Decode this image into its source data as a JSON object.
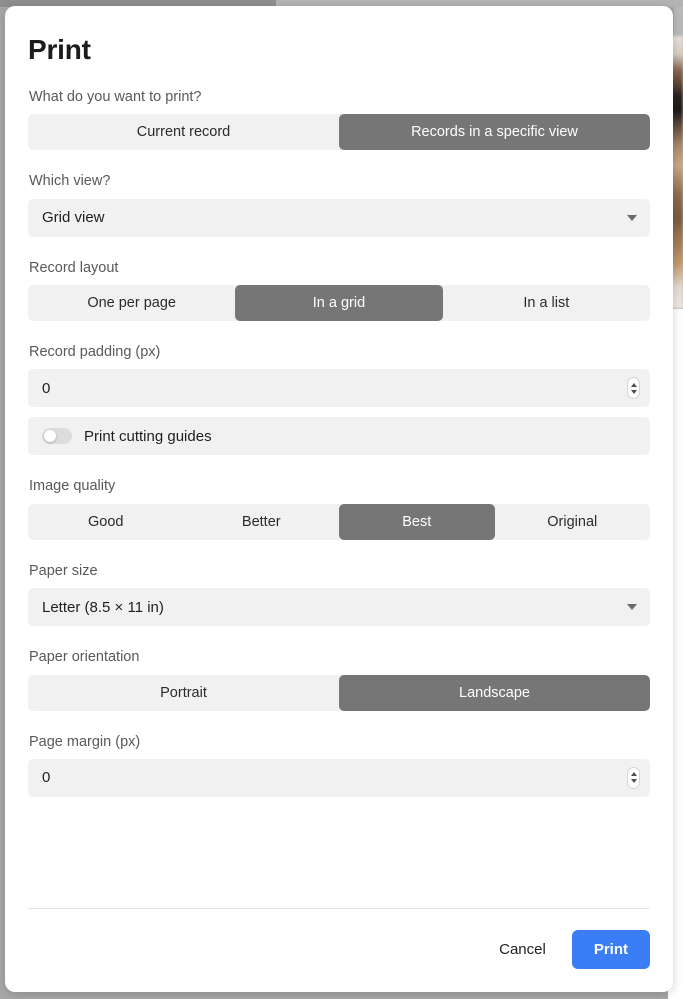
{
  "dialog": {
    "title": "Print",
    "fields": {
      "print_target": {
        "label": "What do you want to print?",
        "options": [
          "Current record",
          "Records in a specific view"
        ],
        "selected_index": 1
      },
      "which_view": {
        "label": "Which view?",
        "value": "Grid view",
        "caret_icon": "chevron-down-icon"
      },
      "record_layout": {
        "label": "Record layout",
        "options": [
          "One per page",
          "In a grid",
          "In a list"
        ],
        "selected_index": 1
      },
      "record_padding": {
        "label": "Record padding (px)",
        "value": "0",
        "stepper_up_icon": "chevron-up-icon",
        "stepper_down_icon": "chevron-down-icon"
      },
      "cutting_guides": {
        "label": "Print cutting guides",
        "enabled": false
      },
      "image_quality": {
        "label": "Image quality",
        "options": [
          "Good",
          "Better",
          "Best",
          "Original"
        ],
        "selected_index": 2
      },
      "paper_size": {
        "label": "Paper size",
        "value": "Letter (8.5 × 11 in)",
        "caret_icon": "chevron-down-icon"
      },
      "paper_orientation": {
        "label": "Paper orientation",
        "options": [
          "Portrait",
          "Landscape"
        ],
        "selected_index": 1
      },
      "page_margin": {
        "label": "Page margin (px)",
        "value": "0",
        "stepper_up_icon": "chevron-up-icon",
        "stepper_down_icon": "chevron-down-icon"
      }
    },
    "footer": {
      "cancel_label": "Cancel",
      "print_label": "Print"
    }
  },
  "colors": {
    "accent": "#3a7df4",
    "segment_selected": "#767676",
    "control_track": "#f1f1f1",
    "label_text": "#59595b",
    "backdrop": "#a8a8a8"
  }
}
